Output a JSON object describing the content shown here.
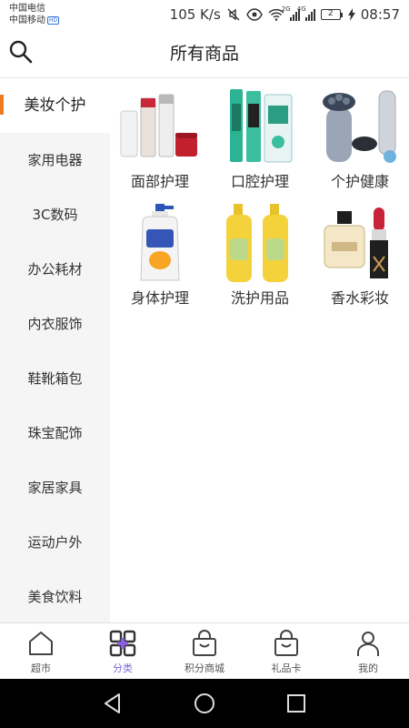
{
  "status_bar": {
    "carrier_1": "中国电信",
    "carrier_2": "中国移动",
    "hd_badge": "HD",
    "net_speed": "105 K/s",
    "sim1_network": "2G",
    "sim2_network": "4G",
    "battery": "2",
    "time": "08:57"
  },
  "header": {
    "title": "所有商品",
    "search_icon": "search-icon"
  },
  "sidebar": {
    "items": [
      {
        "label": "美妆个护",
        "active": true
      },
      {
        "label": "家用电器",
        "active": false
      },
      {
        "label": "3C数码",
        "active": false
      },
      {
        "label": "办公耗材",
        "active": false
      },
      {
        "label": "内衣服饰",
        "active": false
      },
      {
        "label": "鞋靴箱包",
        "active": false
      },
      {
        "label": "珠宝配饰",
        "active": false
      },
      {
        "label": "家居家具",
        "active": false
      },
      {
        "label": "运动户外",
        "active": false
      },
      {
        "label": "美食饮料",
        "active": false
      }
    ],
    "accent_color": "#f07a1e"
  },
  "categories": [
    {
      "label": "面部护理",
      "image": "skincare-bottles"
    },
    {
      "label": "口腔护理",
      "image": "toothpaste"
    },
    {
      "label": "个护健康",
      "image": "electric-shaver"
    },
    {
      "label": "身体护理",
      "image": "body-wash-bottle"
    },
    {
      "label": "洗护用品",
      "image": "shampoo-bottles"
    },
    {
      "label": "香水彩妆",
      "image": "perfume-lipstick"
    }
  ],
  "bottom_nav": {
    "items": [
      {
        "label": "超市",
        "icon": "house-icon",
        "active": false
      },
      {
        "label": "分类",
        "icon": "grid-icon",
        "active": true
      },
      {
        "label": "积分商城",
        "icon": "bag-icon",
        "active": false
      },
      {
        "label": "礼品卡",
        "icon": "bag-icon",
        "active": false
      },
      {
        "label": "我的",
        "icon": "person-icon",
        "active": false
      }
    ],
    "active_color": "#7a6ad8"
  },
  "android_nav": {
    "buttons": [
      "back",
      "home",
      "recents"
    ]
  }
}
